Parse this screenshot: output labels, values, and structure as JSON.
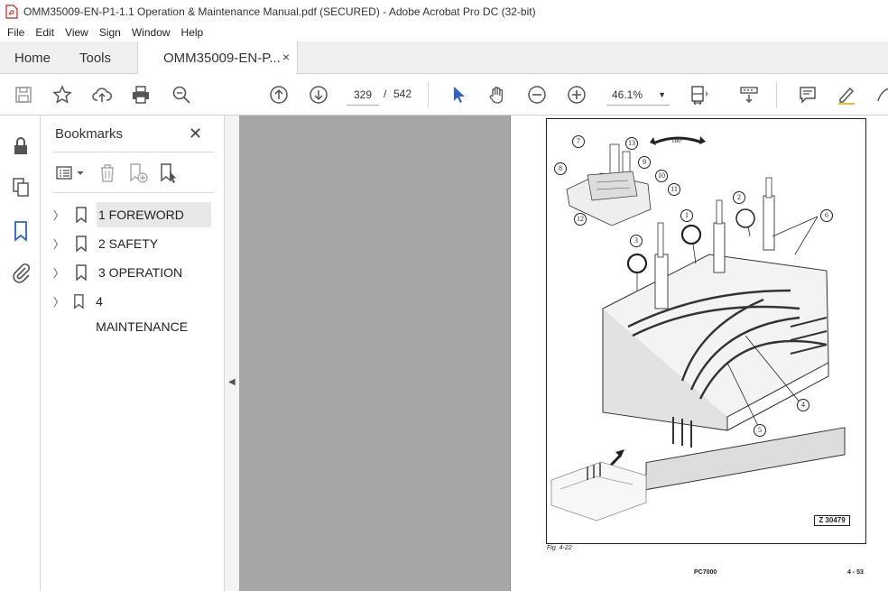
{
  "window": {
    "title": "OMM35009-EN-P1-1.1 Operation & Maintenance Manual.pdf (SECURED) - Adobe Acrobat Pro DC (32-bit)",
    "accent": "#cc1f1f"
  },
  "menu": [
    "File",
    "Edit",
    "View",
    "Sign",
    "Window",
    "Help"
  ],
  "tabs": {
    "home": "Home",
    "tools": "Tools",
    "doc": "OMM35009-EN-P...",
    "close": "×"
  },
  "toolbar": {
    "page_current": "329",
    "page_sep": "/",
    "page_total": "542",
    "zoom": "46.1%",
    "zoom_caret": "▼"
  },
  "bookmarks": {
    "title": "Bookmarks",
    "close": "✕",
    "items": [
      {
        "label": "1 FOREWORD"
      },
      {
        "label": "2 SAFETY"
      },
      {
        "label": "3 OPERATION"
      },
      {
        "label": "4 MAINTENANCE"
      }
    ]
  },
  "page": {
    "rotation_label": "180°",
    "callouts": [
      "1",
      "2",
      "3",
      "4",
      "5",
      "6",
      "7",
      "8",
      "9",
      "10",
      "11",
      "12",
      "13"
    ],
    "zcode": "Z 30479",
    "fig_label": "Fig. 4-22",
    "footer_model": "PC7000",
    "footer_page": "4 - 53"
  }
}
